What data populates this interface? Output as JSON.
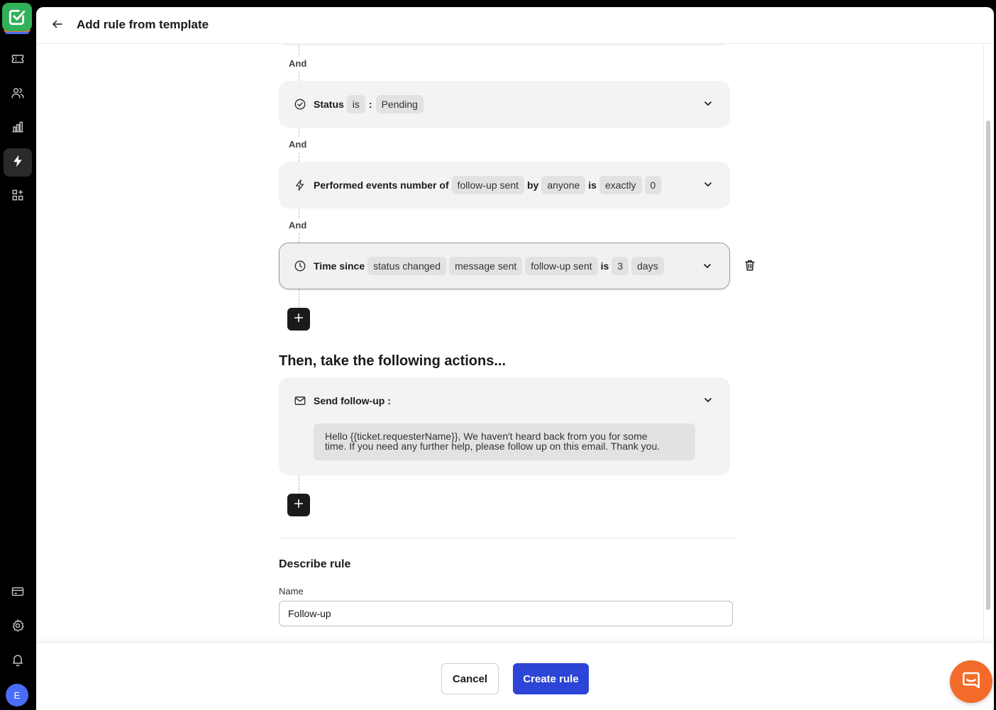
{
  "app": {
    "avatar_initial": "E",
    "brand_color": "#32b05a",
    "accent_color": "#2c45d6"
  },
  "header": {
    "title": "Add rule from template"
  },
  "conditions": {
    "connector": "And",
    "items": [
      {
        "icon": "check-circle-icon",
        "label": "Status",
        "chips": [
          "is"
        ],
        "separator": ":",
        "value": "Pending"
      },
      {
        "icon": "lightning-icon",
        "label": "Performed events number of",
        "chip1": "follow-up sent",
        "word1": "by",
        "chip2": "anyone",
        "word2": "is",
        "chip3": "exactly",
        "chip4": "0"
      },
      {
        "icon": "clock-icon",
        "label": "Time since",
        "chip1": "status changed",
        "chip2": "message sent",
        "chip3": "follow-up sent",
        "word1": "is",
        "chip4": "3",
        "chip5": "days"
      }
    ]
  },
  "actions": {
    "section_title": "Then, take the following actions...",
    "items": [
      {
        "icon": "mail-icon",
        "label": "Send follow-up :",
        "message_line1": "Hello {{ticket.requesterName}}, We haven't heard back from you for some",
        "message_line2": "time. If you need any further help, please follow up on this email. Thank you."
      }
    ]
  },
  "describe": {
    "title": "Describe rule",
    "name_label": "Name",
    "name_value": "Follow-up"
  },
  "footer": {
    "cancel_label": "Cancel",
    "create_label": "Create rule"
  }
}
